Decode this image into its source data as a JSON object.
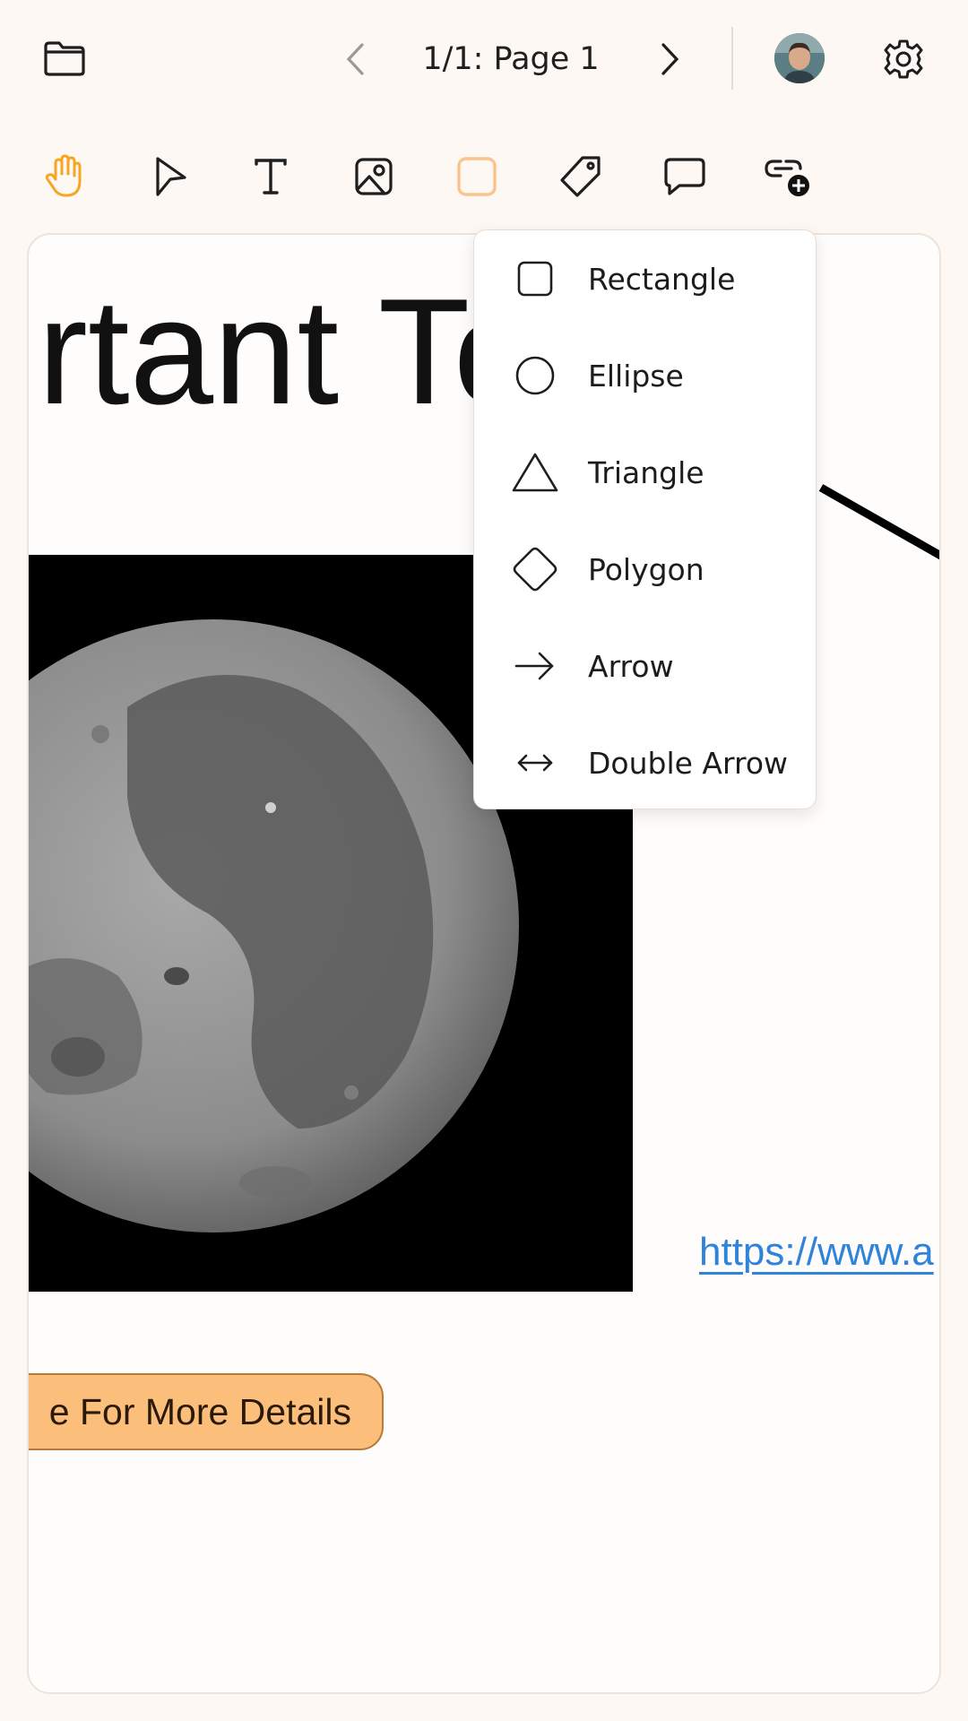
{
  "header": {
    "page_label": "1/1: Page 1",
    "icons": [
      "folder-icon",
      "chevron-left-icon",
      "chevron-right-icon",
      "avatar",
      "gear-icon"
    ]
  },
  "toolbar": {
    "active_tool": "shape",
    "accent_color": "#f5a623",
    "tools": [
      "hand-icon",
      "pointer-icon",
      "text-icon",
      "image-icon",
      "shape-icon",
      "tag-icon",
      "comment-icon",
      "link-add-icon"
    ]
  },
  "canvas": {
    "title_fragment": "rtant To",
    "link_fragment": "https://www.a",
    "button_fragment": "e For More Details"
  },
  "shape_menu": {
    "items": [
      {
        "label": "Rectangle",
        "icon": "rectangle-icon"
      },
      {
        "label": "Ellipse",
        "icon": "ellipse-icon"
      },
      {
        "label": "Triangle",
        "icon": "triangle-icon"
      },
      {
        "label": "Polygon",
        "icon": "polygon-icon"
      },
      {
        "label": "Arrow",
        "icon": "arrow-icon"
      },
      {
        "label": "Double Arrow",
        "icon": "double-arrow-icon"
      }
    ]
  }
}
